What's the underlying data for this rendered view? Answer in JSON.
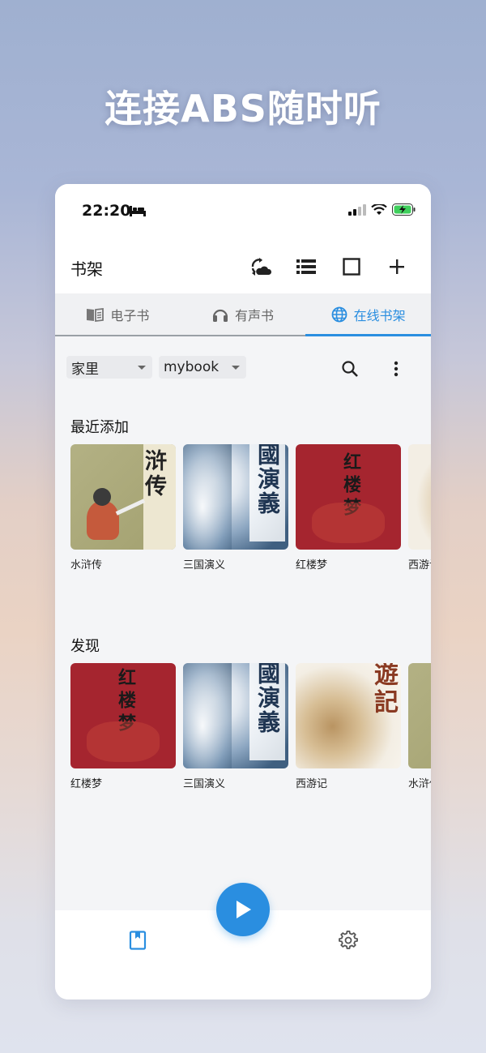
{
  "headline": "连接ABS随时听",
  "status": {
    "time": "22:20"
  },
  "appbar": {
    "title": "书架"
  },
  "tabs": [
    {
      "label": "电子书",
      "icon": "book-open-icon"
    },
    {
      "label": "有声书",
      "icon": "headphones-icon"
    },
    {
      "label": "在线书架",
      "icon": "globe-icon"
    }
  ],
  "filters": {
    "library": "家里",
    "shelf": "mybook"
  },
  "sections": {
    "recent": {
      "title": "最近添加",
      "books": [
        {
          "title": "水浒传",
          "cover_text": "浒传"
        },
        {
          "title": "三国演义",
          "cover_text": "國演義"
        },
        {
          "title": "红楼梦",
          "cover_text": "红楼梦"
        },
        {
          "title": "西游记",
          "cover_text": ""
        }
      ]
    },
    "discover": {
      "title": "发现",
      "books": [
        {
          "title": "红楼梦",
          "cover_text": "红楼梦"
        },
        {
          "title": "三国演义",
          "cover_text": "國演義"
        },
        {
          "title": "西游记",
          "cover_text": "遊記"
        },
        {
          "title": "水浒传",
          "cover_text": ""
        }
      ]
    }
  },
  "colors": {
    "accent": "#2a8ee0",
    "red_cover": "#a5252f",
    "blue_ink": "#2f5277",
    "olive_cover": "#a9a777"
  },
  "nav": {
    "left_icon": "bookshelf-icon",
    "right_icon": "gear-icon",
    "fab_icon": "play-icon"
  }
}
